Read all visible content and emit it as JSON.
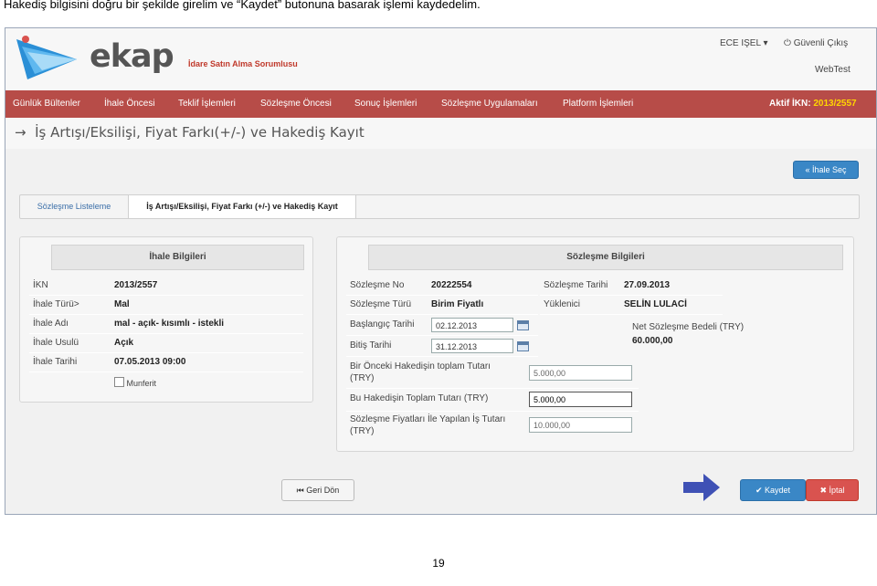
{
  "caption": "Hakediş bilgisini doğru bir şekilde girelim ve “Kaydet” butonuna basarak işlemi kaydedelim.",
  "header": {
    "logo": "ekap",
    "role": "İdare Satın Alma Sorumlusu",
    "user": "ECE IŞEL",
    "logout": "Güvenli Çıkış",
    "environment": "WebTest"
  },
  "nav": {
    "items": [
      "Günlük Bültenler",
      "İhale Öncesi",
      "Teklif İşlemleri",
      "Sözleşme Öncesi",
      "Sonuç İşlemleri",
      "Sözleşme Uygulamaları",
      "Platform İşlemleri"
    ],
    "active_ikn_label": "Aktif İKN:",
    "active_ikn_value": "2013/2557"
  },
  "page": {
    "title": "İş Artışı/Eksilişi, Fiyat Farkı(+/-) ve Hakediş Kayıt",
    "select_button": "İhale Seç"
  },
  "tabs": [
    "Sözleşme Listeleme",
    "İş Artışı/Eksilişi, Fiyat Farkı (+/-) ve Hakediş Kayıt"
  ],
  "ihale": {
    "title": "İhale Bilgileri",
    "rows": [
      {
        "label": "İKN",
        "value": "2013/2557"
      },
      {
        "label": "İhale Türü>",
        "value": "Mal"
      },
      {
        "label": "İhale Adı",
        "value": "mal - açık- kısımlı - istekli"
      },
      {
        "label": "İhale Usulü",
        "value": "Açık"
      },
      {
        "label": "İhale Tarihi",
        "value": "07.05.2013 09:00"
      }
    ],
    "checkbox_label": "Munferit"
  },
  "sozlesme": {
    "title": "Sözleşme Bilgileri",
    "no_label": "Sözleşme No",
    "no_value": "20222554",
    "date_label": "Sözleşme Tarihi",
    "date_value": "27.09.2013",
    "type_label": "Sözleşme Türü",
    "type_value": "Birim Fiyatlı",
    "contractor_label": "Yüklenici",
    "contractor_value": "SELİN LULACİ",
    "start_label": "Başlangıç Tarihi",
    "start_value": "02.12.2013",
    "end_label": "Bitiş Tarihi",
    "end_value": "31.12.2013",
    "net_label": "Net Sözleşme Bedeli (TRY)",
    "net_value": "60.000,00",
    "prev_label_1": "Bir Önceki Hakedişin toplam Tutarı",
    "prev_label_2": "(TRY)",
    "prev_value": "5.000,00",
    "current_label": "Bu Hakedişin Toplam Tutarı (TRY)",
    "current_value": "5.000,00",
    "work_label_1": "Sözleşme Fiyatları İle Yapılan İş Tutarı",
    "work_label_2": "(TRY)",
    "work_value": "10.000,00"
  },
  "actions": {
    "back": "Geri Dön",
    "save": "Kaydet",
    "cancel": "İptal"
  },
  "page_number": "19",
  "colors": {
    "nav": "#b74c48",
    "primary": "#3a87c6",
    "danger": "#d9534f",
    "arrow": "#3f51b5"
  }
}
